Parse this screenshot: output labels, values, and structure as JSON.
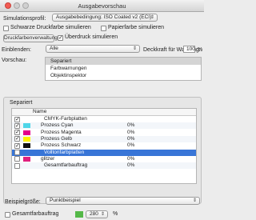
{
  "window": {
    "title": "Ausgabevorschau"
  },
  "simulation": {
    "label": "Simulationsprofil:",
    "profile": "Ausgabebedingung: ISO Coated v2 (ECI)",
    "black_ink": {
      "label": "Schwarze Druckfarbe simulieren",
      "checked": false
    },
    "paper_color": {
      "label": "Papierfarbe simulieren",
      "checked": false
    }
  },
  "ink_manager_button": "Druckfarbenverwaltung",
  "overprint": {
    "label": "Überdruck simulieren",
    "checked": true
  },
  "show": {
    "label": "Einblenden:",
    "value": "Alle",
    "opacity_warning_label": "Deckkraft für Warnung:",
    "opacity_warning_value": "100",
    "unit": "%"
  },
  "preview": {
    "label": "Vorschau:",
    "options": [
      "Separiert",
      "Farbwarnungen",
      "Objektinspektor"
    ],
    "selected": "Separiert"
  },
  "separations": {
    "section_label": "Separiert",
    "column_name": "Name",
    "rows": [
      {
        "name": "CMYK-Farbplatten",
        "percent": "",
        "color": "",
        "checked": true,
        "indent": false,
        "selected": false
      },
      {
        "name": "Prozess Cyan",
        "percent": "0%",
        "color": "#4fd6e8",
        "checked": true,
        "indent": true,
        "selected": false
      },
      {
        "name": "Prozess Magenta",
        "percent": "0%",
        "color": "#e4008a",
        "checked": true,
        "indent": true,
        "selected": false
      },
      {
        "name": "Prozess Gelb",
        "percent": "0%",
        "color": "#fff200",
        "checked": true,
        "indent": true,
        "selected": false
      },
      {
        "name": "Prozess Schwarz",
        "percent": "0%",
        "color": "#111111",
        "checked": true,
        "indent": true,
        "selected": false
      },
      {
        "name": "Volltonfarbplatten",
        "percent": "",
        "color": "",
        "checked": false,
        "indent": false,
        "selected": true
      },
      {
        "name": "glitzer",
        "percent": "0%",
        "color": "#e0207e",
        "checked": false,
        "indent": true,
        "selected": false
      },
      {
        "name": "Gesamtfarbauftrag",
        "percent": "0%",
        "color": "",
        "checked": false,
        "indent": false,
        "selected": false
      }
    ]
  },
  "sample_size": {
    "label": "Beispielgröße:",
    "value": "Punktbeispiel"
  },
  "total_ink": {
    "label": "Gesamtfarbauftrag",
    "checked": false,
    "value": "280",
    "unit": "%",
    "color": "#54b848"
  }
}
